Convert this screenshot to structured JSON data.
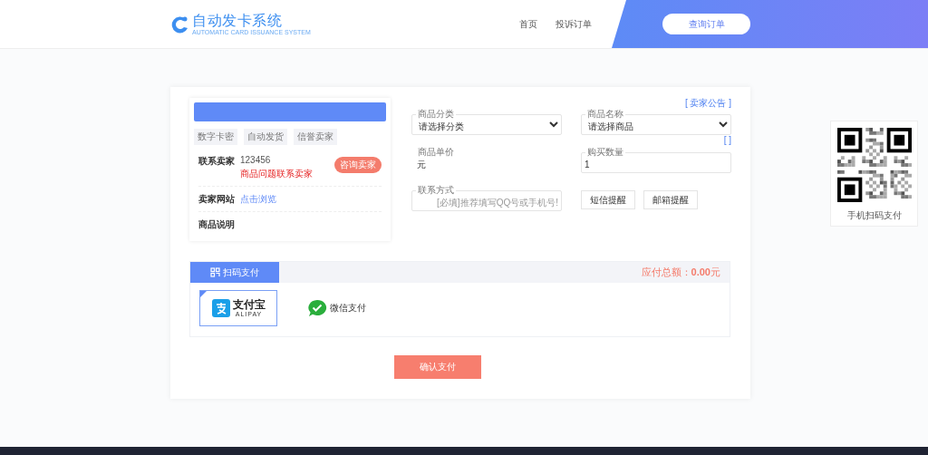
{
  "header": {
    "logo_title": "自动发卡系统",
    "logo_subtitle": "AUTOMATIC CARD ISSUANCE SYSTEM",
    "nav": [
      {
        "label": "首页"
      },
      {
        "label": "投诉订单"
      }
    ],
    "query_button": "查询订单"
  },
  "seller_card": {
    "tags": [
      "数字卡密",
      "自动发货",
      "信誉卖家"
    ],
    "rows": [
      {
        "kind": "contact",
        "label": "联系卖家",
        "value": "123456",
        "note": "商品问题联系卖家",
        "button": "咨询卖家"
      },
      {
        "kind": "link",
        "label": "卖家网站",
        "value": "点击浏览"
      },
      {
        "kind": "plain",
        "label": "商品说明"
      }
    ]
  },
  "form": {
    "notice_link": "[ 卖家公告 ]",
    "quantity_link": "[ ]",
    "fields": [
      {
        "kind": "select",
        "label": "商品分类",
        "value": "请选择分类"
      },
      {
        "kind": "select",
        "label": "商品名称",
        "value": "请选择商品"
      },
      {
        "kind": "static",
        "label": "商品单价",
        "value": "元"
      },
      {
        "kind": "input",
        "label": "购买数量",
        "value": "1"
      },
      {
        "kind": "input",
        "label": "联系方式",
        "placeholder": "[必填]推荐填写QQ号或手机号!"
      }
    ],
    "reminders": [
      "短信提醒",
      "邮箱提醒"
    ]
  },
  "payment": {
    "tab": "扫码支付",
    "total": "应付总额：**0.00**元",
    "methods": [
      {
        "kind": "alipay",
        "name": "支付宝",
        "subtitle": "ALIPAY",
        "selected": true
      },
      {
        "kind": "wechat",
        "name": "微信支付",
        "selected": false
      }
    ]
  },
  "confirm_button": "确认支付",
  "qr_panel": {
    "caption": "手机扫码支付"
  }
}
